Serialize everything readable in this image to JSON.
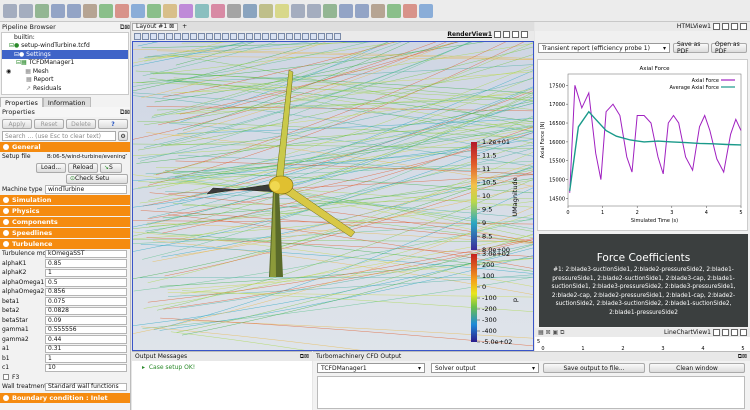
{
  "pipeline": {
    "title": "Pipeline Browser",
    "items": [
      "builtin:",
      "setup-windTurbine.tcfd",
      "Settings",
      "TCFDManager1",
      "Mesh",
      "Report",
      "Residuals"
    ]
  },
  "tabs": {
    "properties": "Properties",
    "information": "Information"
  },
  "props": {
    "title": "Properties",
    "apply": "Apply",
    "reset": "Reset",
    "delete": "Delete",
    "help": "?",
    "search_placeholder": "Search ... (use Esc to clear text)",
    "general": "General",
    "setup_file_label": "Setup file",
    "setup_file_value": "B:06-5/wind-turbine/eveningTest/se",
    "load": "Load...",
    "reload": "Reload",
    "check_setup": "Check Setu",
    "machine_type_label": "Machine type",
    "machine_type_value": "windTurbine",
    "sections": [
      "Simulation",
      "Physics",
      "Components",
      "Speedlines",
      "Turbulence"
    ],
    "turb_model_label": "Turbulence model",
    "turb_model_value": "kOmegaSST",
    "params": [
      [
        "alphaK1",
        "0.85"
      ],
      [
        "alphaK2",
        "1"
      ],
      [
        "alphaOmega1",
        "0.5"
      ],
      [
        "alphaOmega2",
        "0.856"
      ],
      [
        "beta1",
        "0.075"
      ],
      [
        "beta2",
        "0.0828"
      ],
      [
        "betaStar",
        "0.09"
      ],
      [
        "gamma1",
        "0.555556"
      ],
      [
        "gamma2",
        "0.44"
      ],
      [
        "a1",
        "0.31"
      ],
      [
        "b1",
        "1"
      ],
      [
        "c1",
        "10"
      ]
    ],
    "f3": "F3",
    "wall_label": "Wall treatment",
    "wall_value": "Standard wall functions",
    "boundary": "Boundary condition : Inlet"
  },
  "layout": {
    "tab": "Layout #1",
    "plus": "+"
  },
  "render_view": {
    "label": "RenderView1"
  },
  "colorbar_u": {
    "ticks": [
      "1.2e+01",
      "11.5",
      "11",
      "10.5",
      "10",
      "9.5",
      "9",
      "8.5",
      "8.0e+00"
    ],
    "title": "UMagnitude"
  },
  "colorbar_p": {
    "ticks": [
      "3.0e+02",
      "200",
      "100",
      "0",
      "-100",
      "-200",
      "-300",
      "-400",
      "-5.0e+02"
    ],
    "title": "p"
  },
  "html_view": {
    "label": "HTMLView1",
    "report": "Transient report (efficiency probe 1)",
    "save_pdf": "Save as PDF",
    "open_pdf": "Open as PDF"
  },
  "chart_data": {
    "type": "line",
    "title": "Axial Force",
    "xlabel": "Simulated Time (s)",
    "ylabel": "Axial Force (N)",
    "xlim": [
      0,
      5
    ],
    "ylim": [
      14300,
      17800
    ],
    "xticks": [
      0,
      1,
      2,
      3,
      4,
      5
    ],
    "yticks": [
      14500,
      15000,
      15500,
      16000,
      16500,
      17000,
      17500
    ],
    "series": [
      {
        "name": "Axial Force",
        "color": "#a020c0",
        "x": [
          0.05,
          0.2,
          0.4,
          0.6,
          0.8,
          0.95,
          1.1,
          1.3,
          1.5,
          1.7,
          1.85,
          2.0,
          2.2,
          2.4,
          2.6,
          2.75,
          2.9,
          3.05,
          3.2,
          3.4,
          3.6,
          3.8,
          3.95,
          4.1,
          4.3,
          4.5,
          4.7,
          4.85,
          5.0
        ],
        "y": [
          14650,
          17500,
          16900,
          17300,
          15700,
          15000,
          16800,
          17000,
          16700,
          15600,
          15200,
          16700,
          16700,
          16500,
          15600,
          15150,
          16500,
          16700,
          16500,
          15600,
          15250,
          16400,
          16700,
          16300,
          15550,
          15200,
          16200,
          16600,
          16300
        ]
      },
      {
        "name": "Average Axial Force",
        "color": "#1a9a8a",
        "x": [
          0.05,
          0.3,
          0.6,
          0.8,
          1.1,
          1.4,
          1.8,
          2.2,
          2.6,
          3.0,
          3.4,
          3.8,
          4.2,
          4.6,
          5.0
        ],
        "y": [
          14700,
          16400,
          16800,
          16600,
          16300,
          16150,
          16050,
          16000,
          16020,
          16000,
          15980,
          15960,
          15950,
          15930,
          15920
        ]
      }
    ]
  },
  "force": {
    "title": "Force Coefficients",
    "body": "#1: 2:blade3-suctionSide1, 2:blade2-pressureSide2, 2:blade1-pressureSide1, 2:blade2-suctionSide1, 2:blade3-cap, 2:blade1-suctionSide1, 2:blade3-pressureSide2, 2:blade3-pressureSide1, 2:blade2-cap, 2:blade2-pressureSide1, 2:blade1-cap, 2:blade2-suctionSide2, 2:blade3-suctionSide2, 2:blade1-suctionSide2, 2:blade1-pressureSide2"
  },
  "linechart": {
    "label": "LineChartView1",
    "xticks": [
      "0",
      "1",
      "2",
      "3",
      "4",
      "5"
    ],
    "yticks": [
      "5",
      "0"
    ]
  },
  "output": {
    "title": "Output Messages",
    "line": "Case setup OK!"
  },
  "turbo": {
    "title": "Turbomachinery CFD Output",
    "manager": "TCFDManager1",
    "solver": "Solver output",
    "save": "Save output to file...",
    "clean": "Clean window"
  }
}
